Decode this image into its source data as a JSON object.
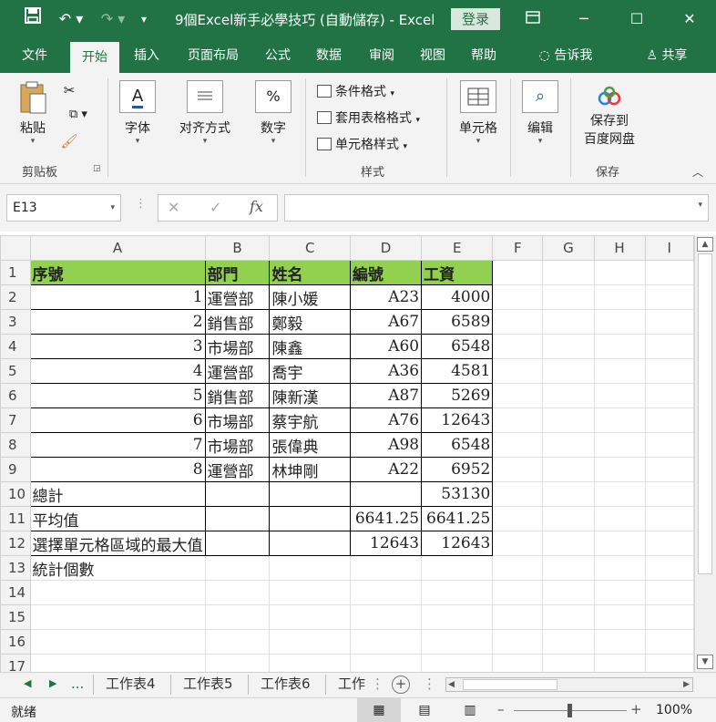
{
  "titlebar": {
    "title": "9個Excel新手必學技巧 (自動儲存)  -  Excel",
    "login": "登录"
  },
  "menu": {
    "tabs": [
      "文件",
      "开始",
      "插入",
      "页面布局",
      "公式",
      "数据",
      "审阅",
      "视图",
      "帮助"
    ],
    "active": "开始",
    "tell_me": "告诉我",
    "share": "共享"
  },
  "ribbon": {
    "paste": "粘贴",
    "clipboard": "剪贴板",
    "font": "字体",
    "align": "对齐方式",
    "number": "数字",
    "number_icon_text": "%",
    "cond_format": "条件格式",
    "table_format": "套用表格格式",
    "cell_style": "单元格样式",
    "styles": "样式",
    "cells": "单元格",
    "edit": "编辑",
    "save_line1": "保存到",
    "save_line2": "百度网盘",
    "save_group": "保存"
  },
  "formula_bar": {
    "name_box": "E13",
    "fx": "fx",
    "formula": ""
  },
  "sheet": {
    "columns": [
      "A",
      "B",
      "C",
      "D",
      "E",
      "F",
      "G",
      "H",
      "I"
    ],
    "rows": [
      [
        "序號",
        "部門",
        "姓名",
        "編號",
        "工資"
      ],
      [
        "1",
        "運營部",
        "陳小媛",
        "A23",
        "4000"
      ],
      [
        "2",
        "銷售部",
        "鄭毅",
        "A67",
        "6589"
      ],
      [
        "3",
        "市場部",
        "陳鑫",
        "A60",
        "6548"
      ],
      [
        "4",
        "運營部",
        "喬宇",
        "A36",
        "4581"
      ],
      [
        "5",
        "銷售部",
        "陳新漢",
        "A87",
        "5269"
      ],
      [
        "6",
        "市場部",
        "蔡宇航",
        "A76",
        "12643"
      ],
      [
        "7",
        "市場部",
        "張偉典",
        "A98",
        "6548"
      ],
      [
        "8",
        "運營部",
        "林坤剛",
        "A22",
        "6952"
      ],
      [
        "總計",
        "",
        "",
        "",
        "53130"
      ],
      [
        "平均值",
        "",
        "",
        "6641.25",
        "6641.25"
      ],
      [
        "選擇單元格區域的最大值",
        "",
        "",
        "12643",
        "12643"
      ],
      [
        "統計個數",
        "",
        "",
        "",
        ""
      ],
      [
        "",
        "",
        "",
        "",
        ""
      ],
      [
        "",
        "",
        "",
        "",
        ""
      ],
      [
        "",
        "",
        "",
        "",
        ""
      ],
      [
        "",
        "",
        "",
        "",
        ""
      ]
    ],
    "header_color": "#92d050"
  },
  "sheet_tabs": {
    "more": "...",
    "tabs": [
      "工作表4",
      "工作表5",
      "工作表6",
      "工作"
    ]
  },
  "status": {
    "mode": "就绪",
    "zoom": "100%"
  },
  "colors": {
    "brand": "#217346",
    "ribbon_bg": "#f3f3f3"
  }
}
